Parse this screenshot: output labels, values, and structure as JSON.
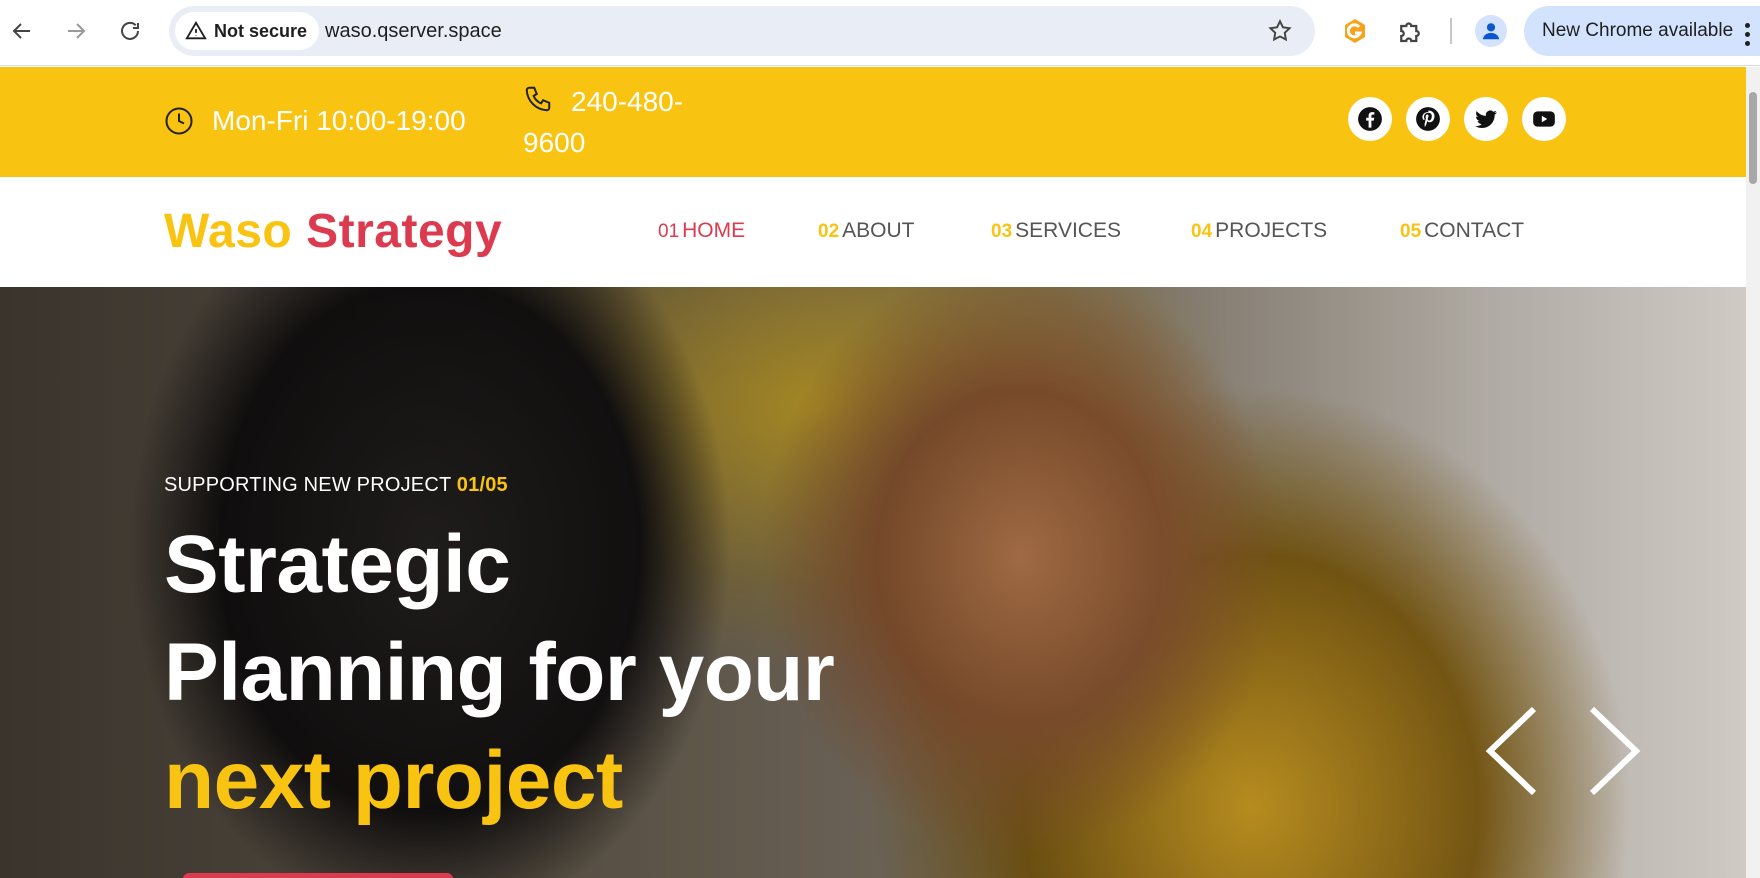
{
  "browser": {
    "security_label": "Not secure",
    "url": "waso.qserver.space",
    "update_label": "New Chrome available"
  },
  "topbar": {
    "hours": "Mon-Fri 10:00-19:00",
    "phone": "240-480-9600",
    "socials": [
      "facebook-icon",
      "pinterest-icon",
      "twitter-icon",
      "youtube-icon"
    ]
  },
  "header": {
    "logo_first": "Waso",
    "logo_second": "Strategy",
    "menu": [
      {
        "num": "01",
        "label": "HOME",
        "active": true
      },
      {
        "num": "02",
        "label": "ABOUT",
        "active": false
      },
      {
        "num": "03",
        "label": "SERVICES",
        "active": false
      },
      {
        "num": "04",
        "label": "PROJECTS",
        "active": false
      },
      {
        "num": "05",
        "label": "CONTACT",
        "active": false
      }
    ]
  },
  "hero": {
    "kicker": "SUPPORTING NEW PROJECT",
    "slide_count": "01/05",
    "headline_line1": "Strategic",
    "headline_line2": "Planning for your",
    "headline_highlight": "next project"
  },
  "colors": {
    "brand_yellow": "#f9c311",
    "brand_red": "#dc3b4f"
  }
}
